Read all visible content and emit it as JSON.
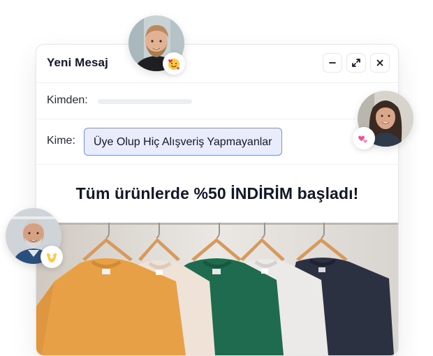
{
  "window": {
    "title": "Yeni Mesaj",
    "controls": {
      "minimize_icon": "minus-icon",
      "expand_icon": "expand-icon",
      "close_icon": "close-icon"
    }
  },
  "fields": {
    "from_label": "Kimden:",
    "to_label": "Kime:",
    "to_value": "Üye Olup Hiç Alışveriş Yapmayanlar"
  },
  "message": {
    "headline": "Tüm ürünlerde %50 İNDİRİM başladı!"
  },
  "banner": {
    "image": "sweatshirts-on-hangers",
    "shirt_colors": [
      "#e8a046",
      "#efe2d6",
      "#1f6b4f",
      "#eceae8",
      "#2c3142"
    ]
  },
  "avatars": [
    {
      "name": "avatar-man-beard",
      "emoji": "smiling-face-with-hearts"
    },
    {
      "name": "avatar-woman-dark-hair",
      "emoji": "two-hearts"
    },
    {
      "name": "avatar-older-man",
      "emoji": "heart-hands"
    }
  ],
  "colors": {
    "chip_border": "#7c8fe6",
    "chip_background": "#e8ecfb"
  }
}
